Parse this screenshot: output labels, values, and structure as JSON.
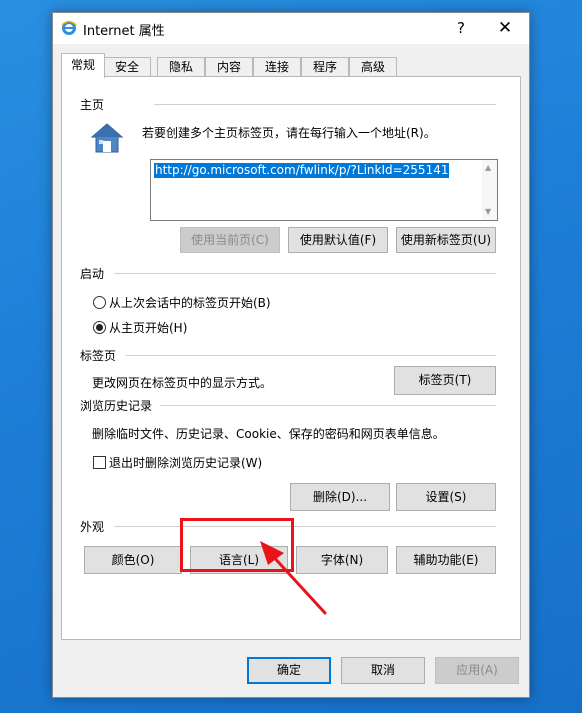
{
  "window": {
    "title": "Internet 属性",
    "help": "?",
    "close": "✕"
  },
  "tabs": [
    {
      "label": "常规",
      "active": true
    },
    {
      "label": "安全"
    },
    {
      "label": "隐私"
    },
    {
      "label": "内容"
    },
    {
      "label": "连接"
    },
    {
      "label": "程序"
    },
    {
      "label": "高级"
    }
  ],
  "home": {
    "section": "主页",
    "instruction": "若要创建多个主页标签页，请在每行输入一个地址(R)。",
    "url": "http://go.microsoft.com/fwlink/p/?LinkId=255141",
    "btn_current": "使用当前页(C)",
    "btn_default": "使用默认值(F)",
    "btn_newtab": "使用新标签页(U)"
  },
  "startup": {
    "section": "启动",
    "option_last_session": "从上次会话中的标签页开始(B)",
    "option_home": "从主页开始(H)"
  },
  "tabs_section": {
    "section": "标签页",
    "description": "更改网页在标签页中的显示方式。",
    "button": "标签页(T)"
  },
  "history": {
    "section": "浏览历史记录",
    "description": "删除临时文件、历史记录、Cookie、保存的密码和网页表单信息。",
    "checkbox": "退出时删除浏览历史记录(W)",
    "btn_delete": "删除(D)...",
    "btn_settings": "设置(S)"
  },
  "appearance": {
    "section": "外观",
    "btn_colors": "颜色(O)",
    "btn_languages": "语言(L)",
    "btn_fonts": "字体(N)",
    "btn_accessibility": "辅助功能(E)"
  },
  "footer": {
    "ok": "确定",
    "cancel": "取消",
    "apply": "应用(A)"
  },
  "colors": {
    "accent": "#0078d7",
    "annotation": "#e8141a"
  }
}
